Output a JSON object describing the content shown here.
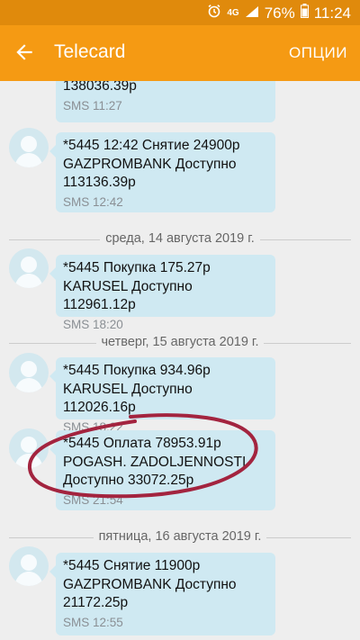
{
  "status_bar": {
    "network": "4G",
    "battery": "76%",
    "time": "11:24"
  },
  "app_bar": {
    "title": "Telecard",
    "options_label": "ОПЦИИ"
  },
  "messages": [
    {
      "text": "138036.39р",
      "meta": "SMS 11:27"
    },
    {
      "text": "*5445 12:42 Снятие 24900р\nGAZPROMBANK Доступно\n113136.39р",
      "meta": "SMS 12:42"
    },
    {
      "text": "*5445 Покупка 175.27р\nKARUSEL Доступно 112961.12р",
      "meta": "SMS 18:20"
    },
    {
      "text": "*5445 Покупка 934.96р\nKARUSEL Доступно 112026.16р",
      "meta": "SMS 18:22"
    },
    {
      "text": "*5445 Оплата 78953.91р\nPOGASH. ZADOLJENNOSTI\nДоступно 33072.25р",
      "meta": "SMS 21:54"
    },
    {
      "text": "*5445 Снятие 11900р\nGAZPROMBANK Доступно\n21172.25р",
      "meta": "SMS 12:55"
    }
  ],
  "dates": [
    "среда, 14 августа 2019 г.",
    "четверг, 15 августа 2019 г.",
    "пятница, 16 августа 2019 г."
  ],
  "colors": {
    "app_bar": "#f59a13",
    "bubble": "#cfe9f2",
    "annotation": "#a3243f"
  }
}
